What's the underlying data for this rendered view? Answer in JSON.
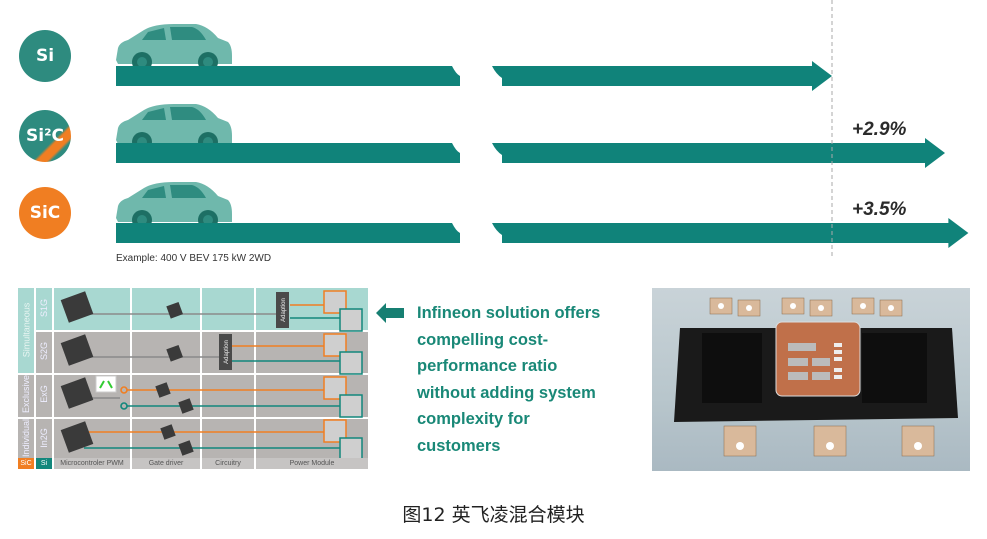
{
  "top_panel": {
    "rows": [
      {
        "badge": "Si",
        "badge_color": "#2e8b7f",
        "percent_label": "",
        "relative_range": 1.0
      },
      {
        "badge": "Si²C",
        "badge_color": "#2e8b7f",
        "badge_accent": "#f07e22",
        "percent_label": "+2.9%",
        "relative_range": 1.029
      },
      {
        "badge": "SiC",
        "badge_color": "#f07e22",
        "percent_label": "+3.5%",
        "relative_range": 1.035
      }
    ],
    "example_text": "Example: 400 V BEV 175 kW 2WD",
    "bar_color": "#10837a",
    "car_color": "#6fb8ac"
  },
  "diagram": {
    "group_labels": [
      "Simultaneous",
      "Exclusive",
      "Individual"
    ],
    "row_labels": [
      "S1G",
      "S2G",
      "ExG",
      "In2G"
    ],
    "adaption_label": "Adaption",
    "legend": [
      {
        "label": "SiC",
        "color": "#f07e22"
      },
      {
        "label": "Si",
        "color": "#12877c"
      }
    ],
    "columns": [
      "Microcontroler PWM",
      "Gate driver",
      "Circuitry",
      "Power Module"
    ],
    "colors": {
      "teal_bg": "#a8d8d1",
      "gray_bg": "#b7b4b2",
      "sic": "#f07e22",
      "si": "#12877c"
    }
  },
  "message": {
    "arrow_color": "#177f72",
    "text": "Infineon solution offers compelling cost-performance ratio without adding system complexity for customers",
    "lines": [
      "Infineon solution offers",
      "compelling cost-",
      "performance ratio",
      "without adding system",
      "complexity for",
      "customers"
    ]
  },
  "photo": {
    "subject": "hybrid power module"
  },
  "caption": "图12  英飞凌混合模块"
}
